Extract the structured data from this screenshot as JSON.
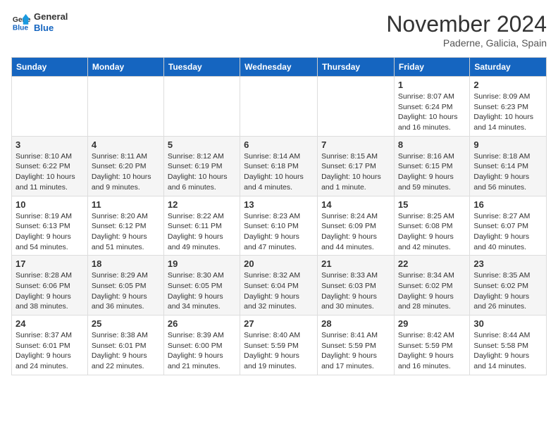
{
  "logo": {
    "line1": "General",
    "line2": "Blue"
  },
  "title": "November 2024",
  "subtitle": "Paderne, Galicia, Spain",
  "days_of_week": [
    "Sunday",
    "Monday",
    "Tuesday",
    "Wednesday",
    "Thursday",
    "Friday",
    "Saturday"
  ],
  "weeks": [
    [
      {
        "day": "",
        "info": ""
      },
      {
        "day": "",
        "info": ""
      },
      {
        "day": "",
        "info": ""
      },
      {
        "day": "",
        "info": ""
      },
      {
        "day": "",
        "info": ""
      },
      {
        "day": "1",
        "info": "Sunrise: 8:07 AM\nSunset: 6:24 PM\nDaylight: 10 hours and 16 minutes."
      },
      {
        "day": "2",
        "info": "Sunrise: 8:09 AM\nSunset: 6:23 PM\nDaylight: 10 hours and 14 minutes."
      }
    ],
    [
      {
        "day": "3",
        "info": "Sunrise: 8:10 AM\nSunset: 6:22 PM\nDaylight: 10 hours and 11 minutes."
      },
      {
        "day": "4",
        "info": "Sunrise: 8:11 AM\nSunset: 6:20 PM\nDaylight: 10 hours and 9 minutes."
      },
      {
        "day": "5",
        "info": "Sunrise: 8:12 AM\nSunset: 6:19 PM\nDaylight: 10 hours and 6 minutes."
      },
      {
        "day": "6",
        "info": "Sunrise: 8:14 AM\nSunset: 6:18 PM\nDaylight: 10 hours and 4 minutes."
      },
      {
        "day": "7",
        "info": "Sunrise: 8:15 AM\nSunset: 6:17 PM\nDaylight: 10 hours and 1 minute."
      },
      {
        "day": "8",
        "info": "Sunrise: 8:16 AM\nSunset: 6:15 PM\nDaylight: 9 hours and 59 minutes."
      },
      {
        "day": "9",
        "info": "Sunrise: 8:18 AM\nSunset: 6:14 PM\nDaylight: 9 hours and 56 minutes."
      }
    ],
    [
      {
        "day": "10",
        "info": "Sunrise: 8:19 AM\nSunset: 6:13 PM\nDaylight: 9 hours and 54 minutes."
      },
      {
        "day": "11",
        "info": "Sunrise: 8:20 AM\nSunset: 6:12 PM\nDaylight: 9 hours and 51 minutes."
      },
      {
        "day": "12",
        "info": "Sunrise: 8:22 AM\nSunset: 6:11 PM\nDaylight: 9 hours and 49 minutes."
      },
      {
        "day": "13",
        "info": "Sunrise: 8:23 AM\nSunset: 6:10 PM\nDaylight: 9 hours and 47 minutes."
      },
      {
        "day": "14",
        "info": "Sunrise: 8:24 AM\nSunset: 6:09 PM\nDaylight: 9 hours and 44 minutes."
      },
      {
        "day": "15",
        "info": "Sunrise: 8:25 AM\nSunset: 6:08 PM\nDaylight: 9 hours and 42 minutes."
      },
      {
        "day": "16",
        "info": "Sunrise: 8:27 AM\nSunset: 6:07 PM\nDaylight: 9 hours and 40 minutes."
      }
    ],
    [
      {
        "day": "17",
        "info": "Sunrise: 8:28 AM\nSunset: 6:06 PM\nDaylight: 9 hours and 38 minutes."
      },
      {
        "day": "18",
        "info": "Sunrise: 8:29 AM\nSunset: 6:05 PM\nDaylight: 9 hours and 36 minutes."
      },
      {
        "day": "19",
        "info": "Sunrise: 8:30 AM\nSunset: 6:05 PM\nDaylight: 9 hours and 34 minutes."
      },
      {
        "day": "20",
        "info": "Sunrise: 8:32 AM\nSunset: 6:04 PM\nDaylight: 9 hours and 32 minutes."
      },
      {
        "day": "21",
        "info": "Sunrise: 8:33 AM\nSunset: 6:03 PM\nDaylight: 9 hours and 30 minutes."
      },
      {
        "day": "22",
        "info": "Sunrise: 8:34 AM\nSunset: 6:02 PM\nDaylight: 9 hours and 28 minutes."
      },
      {
        "day": "23",
        "info": "Sunrise: 8:35 AM\nSunset: 6:02 PM\nDaylight: 9 hours and 26 minutes."
      }
    ],
    [
      {
        "day": "24",
        "info": "Sunrise: 8:37 AM\nSunset: 6:01 PM\nDaylight: 9 hours and 24 minutes."
      },
      {
        "day": "25",
        "info": "Sunrise: 8:38 AM\nSunset: 6:01 PM\nDaylight: 9 hours and 22 minutes."
      },
      {
        "day": "26",
        "info": "Sunrise: 8:39 AM\nSunset: 6:00 PM\nDaylight: 9 hours and 21 minutes."
      },
      {
        "day": "27",
        "info": "Sunrise: 8:40 AM\nSunset: 5:59 PM\nDaylight: 9 hours and 19 minutes."
      },
      {
        "day": "28",
        "info": "Sunrise: 8:41 AM\nSunset: 5:59 PM\nDaylight: 9 hours and 17 minutes."
      },
      {
        "day": "29",
        "info": "Sunrise: 8:42 AM\nSunset: 5:59 PM\nDaylight: 9 hours and 16 minutes."
      },
      {
        "day": "30",
        "info": "Sunrise: 8:44 AM\nSunset: 5:58 PM\nDaylight: 9 hours and 14 minutes."
      }
    ]
  ]
}
